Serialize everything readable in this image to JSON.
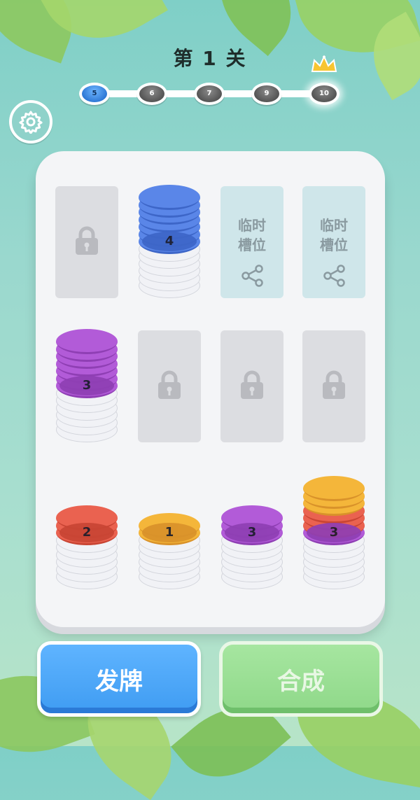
{
  "level_title": "第 1 关",
  "progress": {
    "nodes": [
      {
        "label": "5",
        "state": "current"
      },
      {
        "label": "6",
        "state": "locked"
      },
      {
        "label": "7",
        "state": "locked"
      },
      {
        "label": "9",
        "state": "locked"
      },
      {
        "label": "10",
        "state": "final"
      }
    ],
    "final_icon": "crown-icon"
  },
  "settings_icon": "gear-icon",
  "colors": {
    "blue": "#5a86e8",
    "purple": "#b25bd8",
    "red": "#ea6250",
    "yellow": "#f4b63a"
  },
  "slots": [
    {
      "type": "locked",
      "icon": "lock-icon",
      "stack": []
    },
    {
      "type": "stack",
      "label": "4",
      "stack": [
        {
          "color": "blue",
          "count": 7
        }
      ]
    },
    {
      "type": "temp",
      "label": "临时\n槽位",
      "icon": "share-icon",
      "stack": []
    },
    {
      "type": "temp",
      "label": "临时\n槽位",
      "icon": "share-icon",
      "stack": []
    },
    {
      "type": "stack",
      "label": "3",
      "stack": [
        {
          "color": "purple",
          "count": 7
        }
      ]
    },
    {
      "type": "locked",
      "icon": "lock-icon",
      "stack": []
    },
    {
      "type": "locked",
      "icon": "lock-icon",
      "stack": []
    },
    {
      "type": "locked",
      "icon": "lock-icon",
      "stack": []
    },
    {
      "type": "stack",
      "label": "2",
      "stack": [
        {
          "color": "red",
          "count": 3
        }
      ]
    },
    {
      "type": "stack",
      "label": "1",
      "stack": [
        {
          "color": "yellow",
          "count": 2
        }
      ]
    },
    {
      "type": "stack",
      "label": "3",
      "stack": [
        {
          "color": "purple",
          "count": 3
        }
      ]
    },
    {
      "type": "stack",
      "label": "3",
      "stack": [
        {
          "color": "purple",
          "count": 1
        },
        {
          "color": "red",
          "count": 3
        },
        {
          "color": "yellow",
          "count": 3
        }
      ]
    }
  ],
  "buttons": {
    "deal": "发牌",
    "merge": "合成"
  }
}
